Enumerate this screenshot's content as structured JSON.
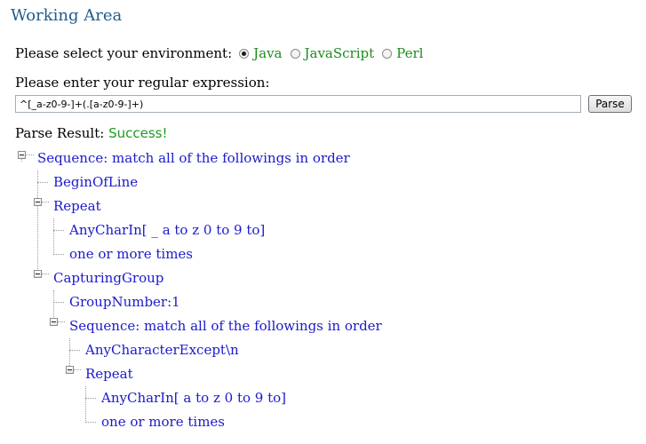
{
  "header": {
    "title": "Working Area"
  },
  "environment": {
    "prompt": "Please select your environment:",
    "options": [
      {
        "label": "Java",
        "selected": true
      },
      {
        "label": "JavaScript",
        "selected": false
      },
      {
        "label": "Perl",
        "selected": false
      }
    ]
  },
  "regex": {
    "prompt": "Please enter your regular expression:",
    "value": "^[_a-z0-9-]+(.[a-z0-9-]+)",
    "parse_label": "Parse"
  },
  "result": {
    "label": "Parse Result:",
    "status": "Success!"
  },
  "tree": {
    "nodes": [
      {
        "label": "Sequence: match all of the followings in order"
      },
      {
        "label": "BeginOfLine"
      },
      {
        "label": "Repeat"
      },
      {
        "label": "AnyCharIn[ _ a to z 0 to 9 to]"
      },
      {
        "label": "one or more times"
      },
      {
        "label": "CapturingGroup"
      },
      {
        "label": "GroupNumber:1"
      },
      {
        "label": "Sequence: match all of the followings in order"
      },
      {
        "label": "AnyCharacterExcept\\n"
      },
      {
        "label": "Repeat"
      },
      {
        "label": "AnyCharIn[ a to z 0 to 9 to]"
      },
      {
        "label": "one or more times"
      }
    ]
  },
  "colors": {
    "title": "#1f5c8e",
    "environment_label": "#1e8b1e",
    "success": "#1e9a1e",
    "tree_node": "#1a1acd"
  }
}
